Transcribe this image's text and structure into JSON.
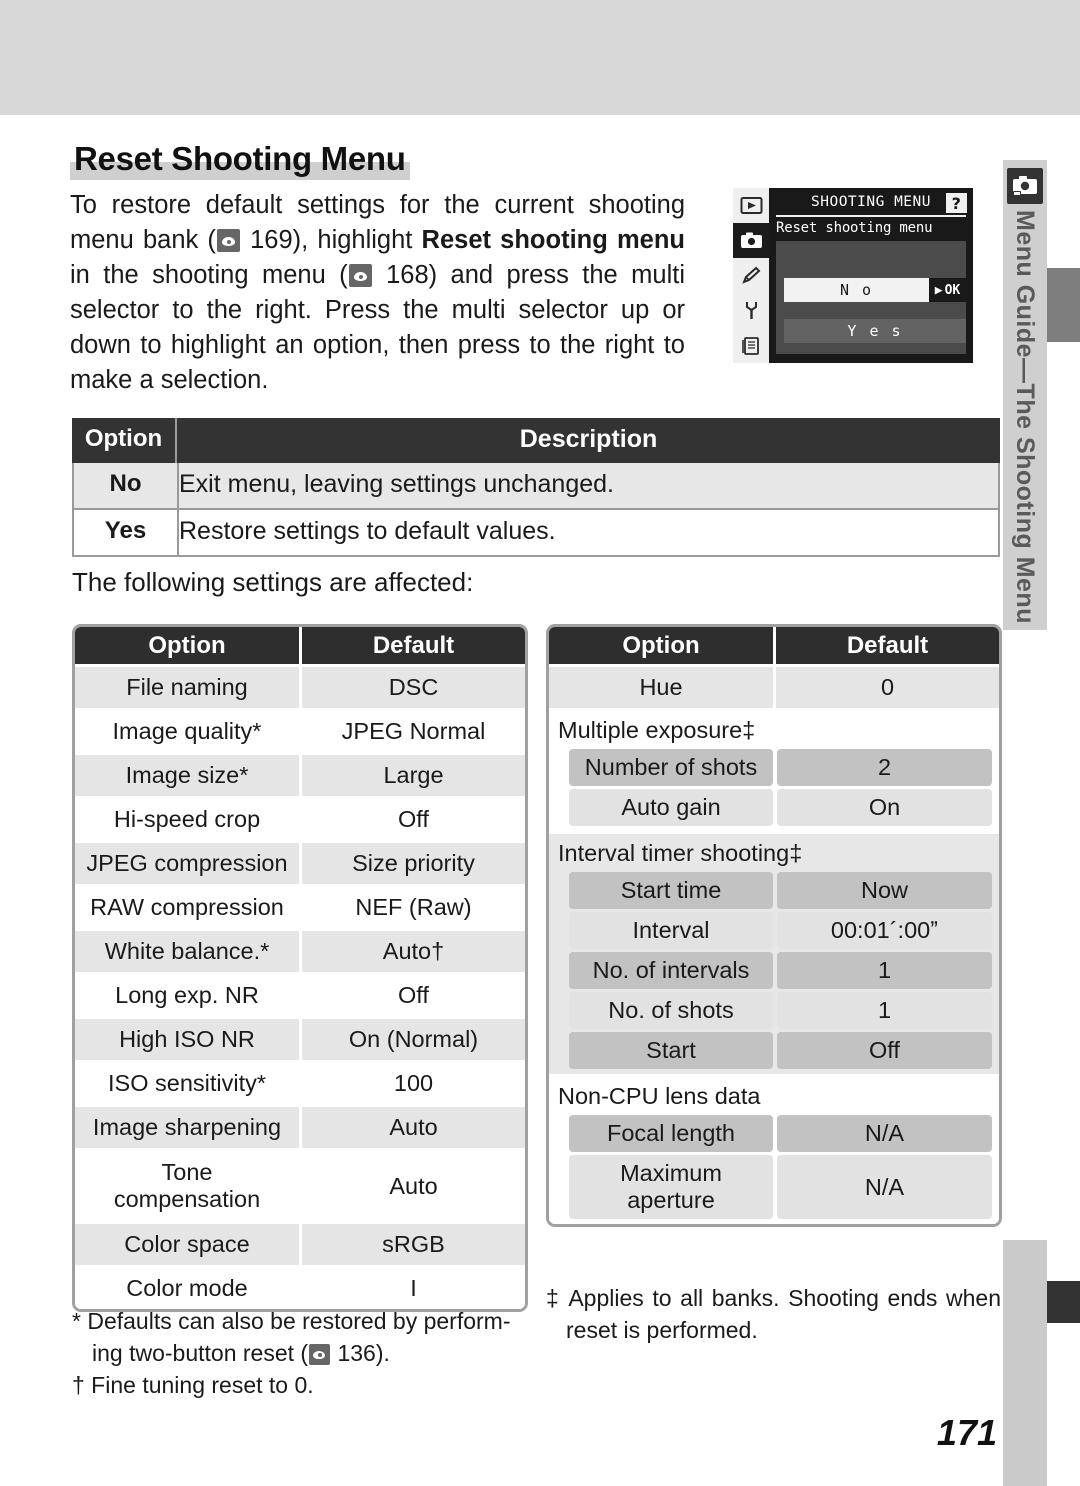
{
  "page_number": "171",
  "side_tab": {
    "label": "Menu Guide—The Shooting Menu",
    "icon": "camera-icon"
  },
  "heading": "Reset Shooting Menu",
  "intro": {
    "p1": "To restore default settings for the current shooting menu bank (",
    "ref1": "169",
    "p2": "), highlight ",
    "b1": "Reset shooting menu",
    "p3": " in the shooting menu (",
    "ref2": "168",
    "p4": ") and press the multi selector to the right.  Press the multi selector up or down to highlight an option, then press to the right to make a selection."
  },
  "lcd": {
    "title": "SHOOTING MENU",
    "help": "?",
    "subtitle": "Reset shooting menu",
    "option_no": "N o",
    "ok_label": "OK",
    "ok_arrow": "▶",
    "option_yes": "Y e s",
    "icons": [
      "playback-icon",
      "camera-icon",
      "pencil-icon",
      "wrench-icon",
      "pages-icon"
    ]
  },
  "desc_table": {
    "headers": [
      "Option",
      "Description"
    ],
    "rows": [
      {
        "option": "No",
        "description": "Exit menu, leaving settings unchanged."
      },
      {
        "option": "Yes",
        "description": "Restore settings to default values."
      }
    ]
  },
  "following_line": "The following settings are affected:",
  "left_table": {
    "headers": [
      "Option",
      "Default"
    ],
    "rows": [
      {
        "option": "File naming",
        "default": "DSC"
      },
      {
        "option": "Image quality*",
        "default": "JPEG Normal"
      },
      {
        "option": "Image size*",
        "default": "Large"
      },
      {
        "option": "Hi-speed crop",
        "default": "Off"
      },
      {
        "option": "JPEG compression",
        "default": "Size priority"
      },
      {
        "option": "RAW compression",
        "default": "NEF (Raw)"
      },
      {
        "option": "White balance.*",
        "default": "Auto†"
      },
      {
        "option": "Long exp. NR",
        "default": "Off"
      },
      {
        "option": "High ISO NR",
        "default": "On (Normal)"
      },
      {
        "option": "ISO sensitivity*",
        "default": "100"
      },
      {
        "option": "Image sharpening",
        "default": "Auto"
      },
      {
        "option": "Tone compensation",
        "default": "Auto"
      },
      {
        "option": "Color space",
        "default": "sRGB"
      },
      {
        "option": "Color mode",
        "default": "I"
      }
    ]
  },
  "right_table": {
    "headers": [
      "Option",
      "Default"
    ],
    "simple_rows": [
      {
        "option": "Hue",
        "default": "0"
      }
    ],
    "groups": [
      {
        "title": "Multiple exposure‡",
        "rows": [
          {
            "option": "Number of shots",
            "default": "2"
          },
          {
            "option": "Auto gain",
            "default": "On"
          }
        ]
      },
      {
        "title": "Interval timer shooting‡",
        "rows": [
          {
            "option": "Start time",
            "default": "Now"
          },
          {
            "option": "Interval",
            "default": "00:01´:00ˮ"
          },
          {
            "option": "No. of intervals",
            "default": "1"
          },
          {
            "option": "No. of shots",
            "default": "1"
          },
          {
            "option": "Start",
            "default": "Off"
          }
        ]
      },
      {
        "title": "Non-CPU lens data",
        "rows": [
          {
            "option": "Focal length",
            "default": "N/A"
          },
          {
            "option": "Maximum aperture",
            "default": "N/A"
          }
        ]
      }
    ]
  },
  "footnotes": {
    "left_star_a": "* Defaults can also be restored by perform-",
    "left_star_b": "ing two-button reset (",
    "left_star_ref": "136",
    "left_star_c": ").",
    "left_dagger": "† Fine tuning reset to 0.",
    "right_a": "‡ Applies  to  all  banks.   Shooting  ends",
    "right_b": "when reset is performed."
  }
}
